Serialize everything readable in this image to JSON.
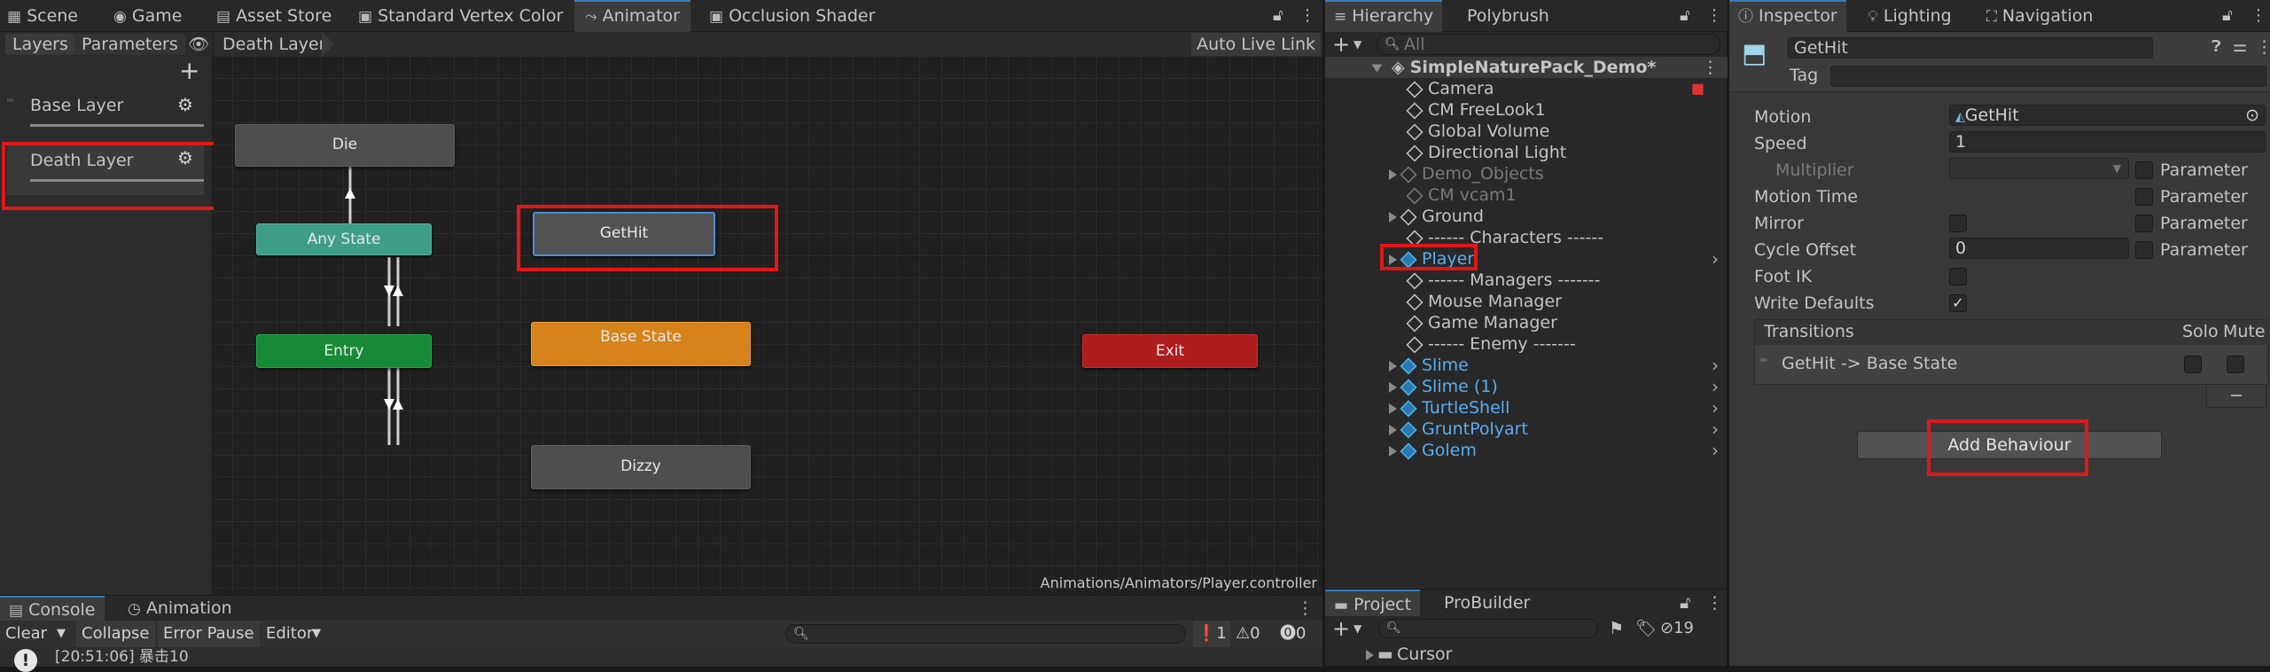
{
  "top_tabs": {
    "scene": "Scene",
    "game": "Game",
    "asset_store": "Asset Store",
    "vertex_color": "Standard Vertex Color",
    "animator": "Animator",
    "occlusion": "Occlusion Shader"
  },
  "animator": {
    "layers_tab": "Layers",
    "parameters_tab": "Parameters",
    "breadcrumb": "Death Layer",
    "auto_live_link": "Auto Live Link",
    "layers": [
      {
        "name": "Base Layer"
      },
      {
        "name": "Death Layer"
      }
    ],
    "nodes": {
      "die": "Die",
      "any_state": "Any State",
      "gethit": "GetHit",
      "entry": "Entry",
      "base_state": "Base State",
      "exit": "Exit",
      "dizzy": "Dizzy"
    },
    "path": "Animations/Animators/Player.controller"
  },
  "hierarchy": {
    "tab": "Hierarchy",
    "tab2": "Polybrush",
    "search_placeholder": "All",
    "scene_name": "SimpleNaturePack_Demo*",
    "items": [
      "Camera",
      "CM FreeLook1",
      "Global Volume",
      "Directional Light",
      "Demo_Objects",
      "CM vcam1",
      "Ground",
      "------ Characters ------",
      "Player",
      "------ Managers -------",
      "Mouse Manager",
      "Game Manager",
      "------ Enemy -------",
      "Slime",
      "Slime (1)",
      "TurtleShell",
      "GruntPolyart",
      "Golem"
    ]
  },
  "inspector": {
    "tab": "Inspector",
    "tab_lighting": "Lighting",
    "tab_navigation": "Navigation",
    "object_name": "GetHit",
    "tag_label": "Tag",
    "motion_label": "Motion",
    "motion_value": "GetHit",
    "speed_label": "Speed",
    "speed_value": "1",
    "multiplier_label": "Multiplier",
    "motion_time_label": "Motion Time",
    "mirror_label": "Mirror",
    "cycle_offset_label": "Cycle Offset",
    "cycle_offset_value": "0",
    "foot_ik_label": "Foot IK",
    "write_defaults_label": "Write Defaults",
    "parameter_label": "Parameter",
    "transitions_label": "Transitions",
    "solo_label": "Solo",
    "mute_label": "Mute",
    "transition_item": "GetHit -> Base State",
    "add_behaviour": "Add Behaviour"
  },
  "console": {
    "tab": "Console",
    "tab2": "Animation",
    "clear": "Clear",
    "collapse": "Collapse",
    "error_pause": "Error Pause",
    "editor": "Editor",
    "count_log": "1",
    "count_warn": "0",
    "count_err": "0",
    "log_line": "[20:51:06] 暴击10"
  },
  "project": {
    "tab": "Project",
    "tab2": "ProBuilder",
    "hidden_count": "19",
    "folder": "Cursor"
  }
}
